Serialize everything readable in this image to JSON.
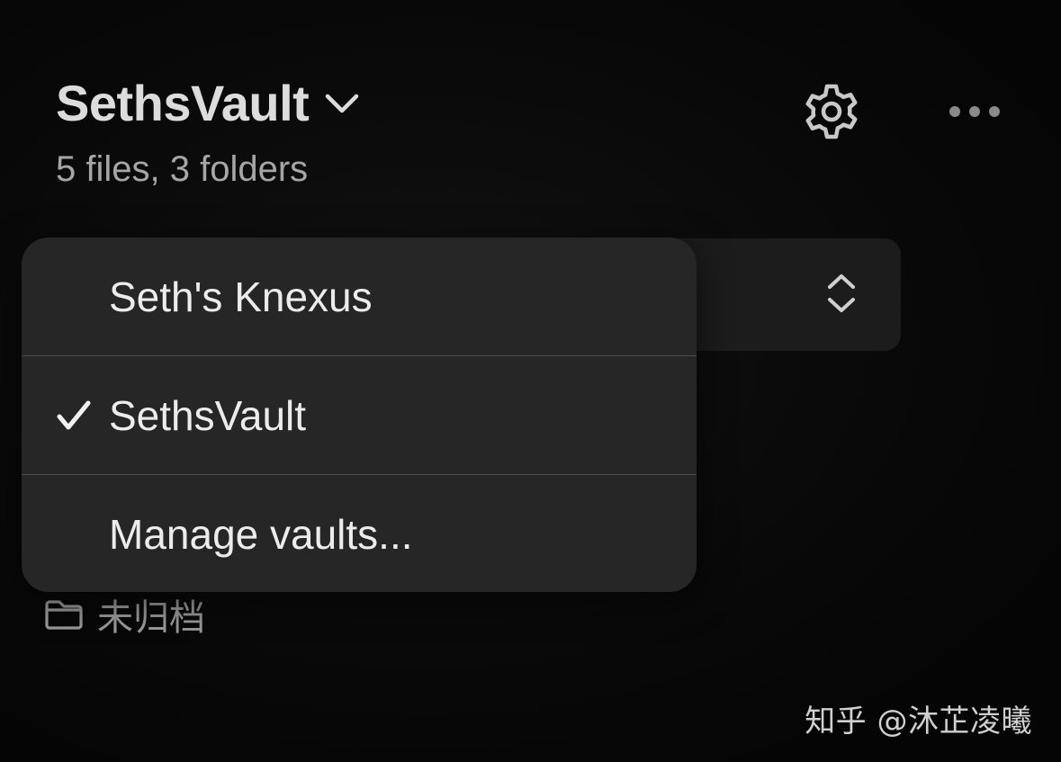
{
  "header": {
    "vault_name": "SethsVault",
    "summary": "5 files, 3 folders",
    "title_icon": "chevron-down-icon",
    "settings_icon": "gear-icon",
    "more_icon": "ellipsis-icon"
  },
  "sort_bar": {
    "toggle_icon": "chevron-up-down-icon"
  },
  "vault_menu": {
    "items": [
      {
        "label": "Seth's Knexus",
        "selected": false
      },
      {
        "label": "SethsVault",
        "selected": true
      },
      {
        "label": "Manage vaults...",
        "selected": false
      }
    ],
    "check_icon": "checkmark-icon"
  },
  "folders": [
    {
      "label": "未归档",
      "icon": "folder-icon"
    }
  ],
  "watermark": "知乎 @沐芷凌曦",
  "colors": {
    "background": "#060606",
    "menu_background": "#262626",
    "title_text": "#dcdcdc",
    "secondary_text": "#a6a6a6"
  }
}
